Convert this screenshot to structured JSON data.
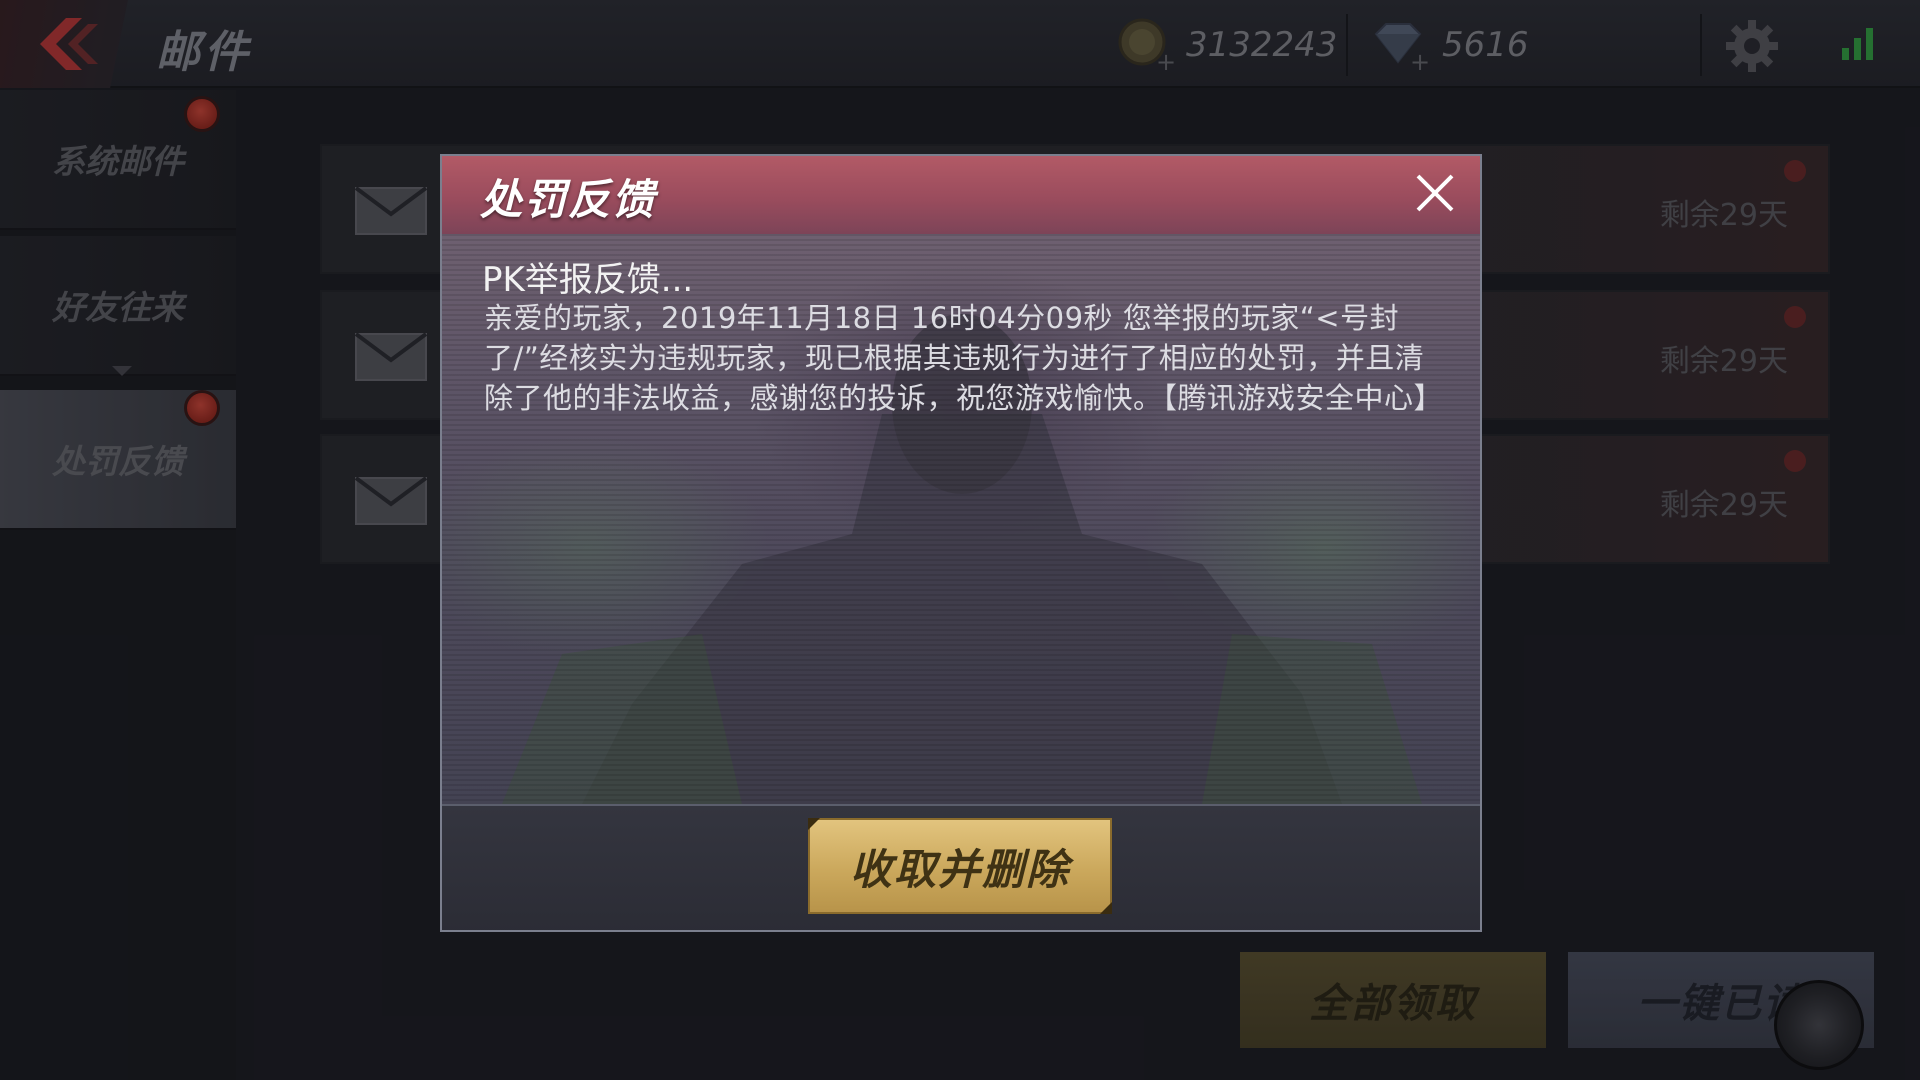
{
  "topbar": {
    "title": "邮件",
    "gold": "3132243",
    "diamonds": "5616",
    "icons": [
      "back-arrow-icon",
      "gold-coin-icon",
      "diamond-icon",
      "gear-icon",
      "signal-icon"
    ]
  },
  "sidebar": {
    "items": [
      {
        "label": "系统邮件",
        "badge": true
      },
      {
        "label": "好友往来",
        "badge": false
      },
      {
        "label": "处罚反馈",
        "badge": true
      }
    ]
  },
  "mails": [
    {
      "days_left": "剩余29天"
    },
    {
      "days_left": "剩余29天"
    },
    {
      "days_left": "剩余29天"
    }
  ],
  "actions": {
    "claim_all": "全部领取",
    "read_all": "一键已读"
  },
  "modal": {
    "title": "处罚反馈",
    "message_title": "PK举报反馈...",
    "message_body": "亲爱的玩家，2019年11月18日 16时04分09秒 您举报的玩家“<号封了/”经核实为违规玩家，现已根据其违规行为进行了相应的处罚，并且清除了他的非法收益，感谢您的投诉，祝您游戏愉快。【腾讯游戏安全中心】",
    "confirm_label": "收取并删除"
  },
  "colors": {
    "accent_gold": "#cba85c",
    "header_red": "#9a4c5d",
    "badge_red": "#d64a3c",
    "signal_green": "#35a845"
  }
}
